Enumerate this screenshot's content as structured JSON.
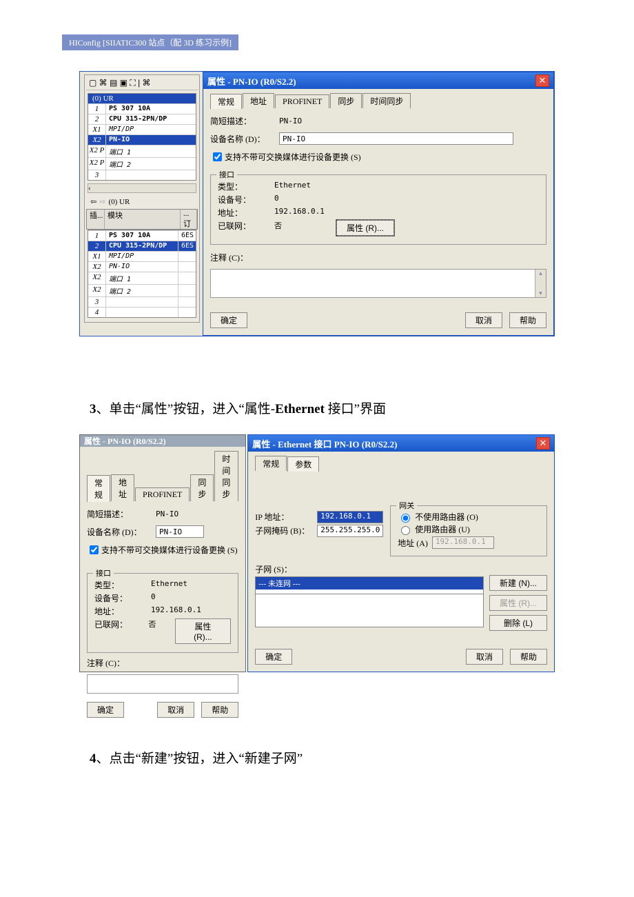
{
  "doc": {
    "tag": "HIConfig [SIIATIC300 站点（配 3D   练习示例]",
    "step3": "3、单击“属性”按钮，进入“属性-Ethernet 接口”界面",
    "step4": "4、点击“新建”按钮，进入“新建子网”"
  },
  "hw": {
    "toolbar_glyphs": "▢ ⌘ ▤ ▣ ⛶ | ⌘",
    "rack_head": "(0) UR",
    "top_rows": [
      {
        "slot": "1",
        "mod": "PS 307 10A",
        "sel": false,
        "italic": false
      },
      {
        "slot": "2",
        "mod": "CPU 315-2PN/DP",
        "sel": false,
        "italic": false
      },
      {
        "slot": "X1",
        "mod": "MPI/DP",
        "sel": false,
        "italic": true
      },
      {
        "slot": "X2",
        "mod": "PN-IO",
        "sel": true,
        "italic": false
      },
      {
        "slot": "X2 P",
        "mod": "端口 1",
        "sel": false,
        "italic": true
      },
      {
        "slot": "X2 P",
        "mod": "端口 2",
        "sel": false,
        "italic": true
      },
      {
        "slot": "3",
        "mod": "",
        "sel": false,
        "italic": false
      }
    ],
    "nav_label": "(0)   UR",
    "cols": {
      "slot": "插...",
      "mod": "模块",
      "ord": "... 订"
    },
    "bottom_rows": [
      {
        "slot": "1",
        "mod": "PS 307 10A",
        "ord": "6ES",
        "sel": false,
        "italic": false
      },
      {
        "slot": "2",
        "mod": "CPU 315-2PN/DP",
        "ord": "6ES",
        "sel": true,
        "italic": false
      },
      {
        "slot": "X1",
        "mod": "MPI/DP",
        "ord": "",
        "sel": false,
        "italic": true
      },
      {
        "slot": "X2",
        "mod": "PN-IO",
        "ord": "",
        "sel": false,
        "italic": true
      },
      {
        "slot": "X2",
        "mod": "端口 1",
        "ord": "",
        "sel": false,
        "italic": true
      },
      {
        "slot": "X2",
        "mod": "端口 2",
        "ord": "",
        "sel": false,
        "italic": true
      },
      {
        "slot": "3",
        "mod": "",
        "ord": "",
        "sel": false,
        "italic": false
      },
      {
        "slot": "4",
        "mod": "",
        "ord": "",
        "sel": false,
        "italic": false
      }
    ]
  },
  "dlg1": {
    "title": "属性 - PN-IO (R0/S2.2)",
    "tabs": [
      "常规",
      "地址",
      "PROFINET",
      "同步",
      "时间同步"
    ],
    "short_desc_lbl": "简短描述：",
    "short_desc_val": "PN-IO",
    "devname_lbl": "设备名称 (D)：",
    "devname_val": "PN-IO",
    "swap_cb": "支持不带可交换媒体进行设备更换 (S)",
    "group_title": "接口",
    "type_lbl": "类型：",
    "type_val": "Ethernet",
    "devno_lbl": "设备号：",
    "devno_val": "0",
    "addr_lbl": "地址：",
    "addr_val": "192.168.0.1",
    "net_lbl": "已联网：",
    "net_val": "否",
    "prop_btn": "属性 (R)...",
    "comment_lbl": "注释 (C)：",
    "ok": "确定",
    "cancel": "取消",
    "help": "帮助"
  },
  "dlg2": {
    "title": "属性 - Ethernet 接口  PN-IO (R0/S2.2)",
    "tabs": [
      "常规",
      "参数"
    ],
    "ip_lbl": "IP 地址：",
    "ip_val": "192.168.0.1",
    "mask_lbl": "子网掩码 (B)：",
    "mask_val": "255.255.255.0",
    "gw_group": "网关",
    "gw_no": "不使用路由器 (O)",
    "gw_yes": "使用路由器 (U)",
    "gw_addr_lbl": "地址 (A)",
    "gw_addr_val": "192.168.0.1",
    "subnet_lbl": "子网 (S)：",
    "subnet_entry": "--- 未连网 ---",
    "new_btn": "新建 (N)...",
    "prop_btn": "属性 (R)...",
    "del_btn": "删除 (L)",
    "ok": "确定",
    "cancel": "取消",
    "help": "帮助"
  }
}
